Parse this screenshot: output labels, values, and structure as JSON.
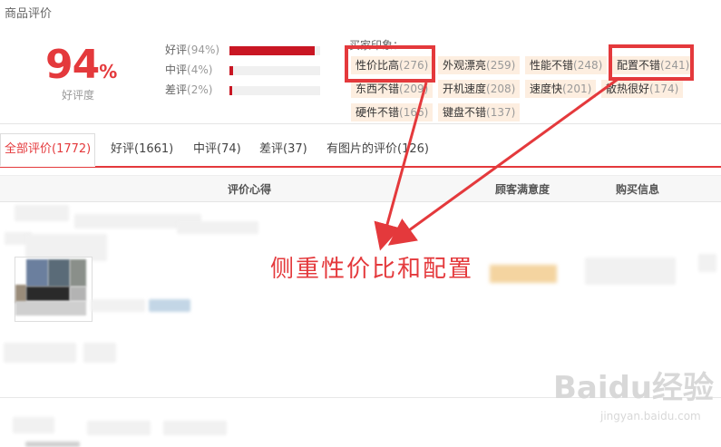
{
  "section_title": "商品评价",
  "rating": {
    "value": "94",
    "unit": "%",
    "label": "好评度"
  },
  "distribution": [
    {
      "label": "好评",
      "count": "(94%)",
      "fraction": 0.94
    },
    {
      "label": "中评",
      "count": "(4%)",
      "fraction": 0.04
    },
    {
      "label": "差评",
      "count": "(2%)",
      "fraction": 0.02
    }
  ],
  "impressions": {
    "title": "买家印象：",
    "tags": [
      {
        "text": "性价比高",
        "count": "(276)"
      },
      {
        "text": "外观漂亮",
        "count": "(259)"
      },
      {
        "text": "性能不错",
        "count": "(248)"
      },
      {
        "text": "配置不错",
        "count": "(241)"
      },
      {
        "text": "东西不错",
        "count": "(209)"
      },
      {
        "text": "开机速度",
        "count": "(208)"
      },
      {
        "text": "速度快",
        "count": "(201)"
      },
      {
        "text": "散热很好",
        "count": "(174)"
      },
      {
        "text": "硬件不错",
        "count": "(166)"
      },
      {
        "text": "键盘不错",
        "count": "(137)"
      }
    ]
  },
  "tabs": [
    {
      "label": "全部评价(1772)",
      "active": true
    },
    {
      "label": "好评(1661)"
    },
    {
      "label": "中评(74)"
    },
    {
      "label": "差评(37)"
    },
    {
      "label": "有图片的评价(126)"
    }
  ],
  "columns": {
    "content": "评价心得",
    "satisfaction": "顾客满意度",
    "purchase": "购买信息"
  },
  "annotation": "侧重性价比和配置",
  "watermark": {
    "brand": "Baidu经验",
    "url": "jingyan.baidu.com"
  },
  "colors": {
    "accent": "#e4393c",
    "bar": "#c91623",
    "tag_bg": "#fdeee0"
  }
}
